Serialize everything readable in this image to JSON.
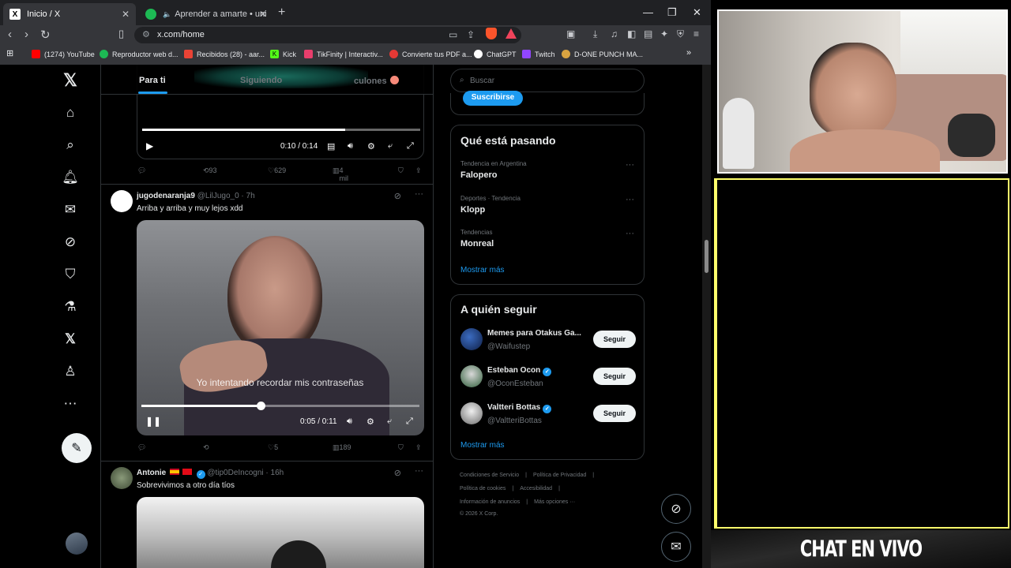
{
  "browser": {
    "tabs": [
      {
        "title": "Inicio / X",
        "icon": "x-logo-icon"
      },
      {
        "title": "Aprender a amarte • uni",
        "icon": "spotify-icon"
      }
    ],
    "url": "x.com/home",
    "bookmarks": [
      {
        "label": "(1274) YouTube",
        "color": "#ff0000"
      },
      {
        "label": "Reproductor web d...",
        "color": "#1db954"
      },
      {
        "label": "Recibidos (28) - aar...",
        "color": "#ea4335"
      },
      {
        "label": "Kick",
        "color": "#53fc18"
      },
      {
        "label": "TikFinity | Interactiv...",
        "color": "#e83e6c"
      },
      {
        "label": "Convierte tus PDF a...",
        "color": "#e53935"
      },
      {
        "label": "ChatGPT",
        "color": "#ffffff"
      },
      {
        "label": "Twitch",
        "color": "#9146ff"
      },
      {
        "label": "D-ONE PUNCH MA...",
        "color": "#d9a441"
      }
    ]
  },
  "feed": {
    "tabs": [
      "Para ti",
      "Siguiendo",
      "culones"
    ],
    "first_video": {
      "time": "0:10 / 0:14",
      "progress": 0.73
    },
    "first_actions": {
      "retweets": "93",
      "likes": "629",
      "views": "4 mil"
    },
    "post1": {
      "name": "jugodenaranja9",
      "handle": "@LilJugo_0 · 7h",
      "text": "Arriba y arriba y muy lejos xdd",
      "subtitle": "Yo intentando recordar mis contraseñas",
      "time": "0:05 / 0:11",
      "progress": 0.43,
      "likes": "5",
      "views": "189"
    },
    "post2": {
      "name": "Antonie",
      "handle": "@tip0DeIncogni · 16h",
      "text": "Sobrevivimos a otro día tíos"
    }
  },
  "sidebar": {
    "search_placeholder": "Buscar",
    "subscribe_label": "Suscribirse",
    "trends_title": "Qué está pasando",
    "trends": [
      {
        "meta": "Tendencia en Argentina",
        "name": "Falopero"
      },
      {
        "meta": "Deportes · Tendencia",
        "name": "Klopp"
      },
      {
        "meta": "Tendencias",
        "name": "Monreal"
      }
    ],
    "show_more": "Mostrar más",
    "follow_title": "A quién seguir",
    "follow": [
      {
        "name": "Memes para Otakus Ga...",
        "handle": "@Waifustep",
        "verified": false
      },
      {
        "name": "Esteban Ocon",
        "handle": "@OconEsteban",
        "verified": true
      },
      {
        "name": "Valtteri Bottas",
        "handle": "@ValtteriBottas",
        "verified": true
      }
    ],
    "follow_label": "Seguir",
    "footer": [
      [
        "Condiciones de Servicio",
        "|",
        "Política de Privacidad",
        "|"
      ],
      [
        "Política de cookies",
        "|",
        "Accesibilidad",
        "|"
      ],
      [
        "Información de anuncios",
        "|",
        "Más opciones ···"
      ],
      [
        "© 2026 X Corp."
      ]
    ]
  },
  "overlay": {
    "chat_label": "CHAT EN VIVO",
    "frame_color": "#ffff6b"
  }
}
